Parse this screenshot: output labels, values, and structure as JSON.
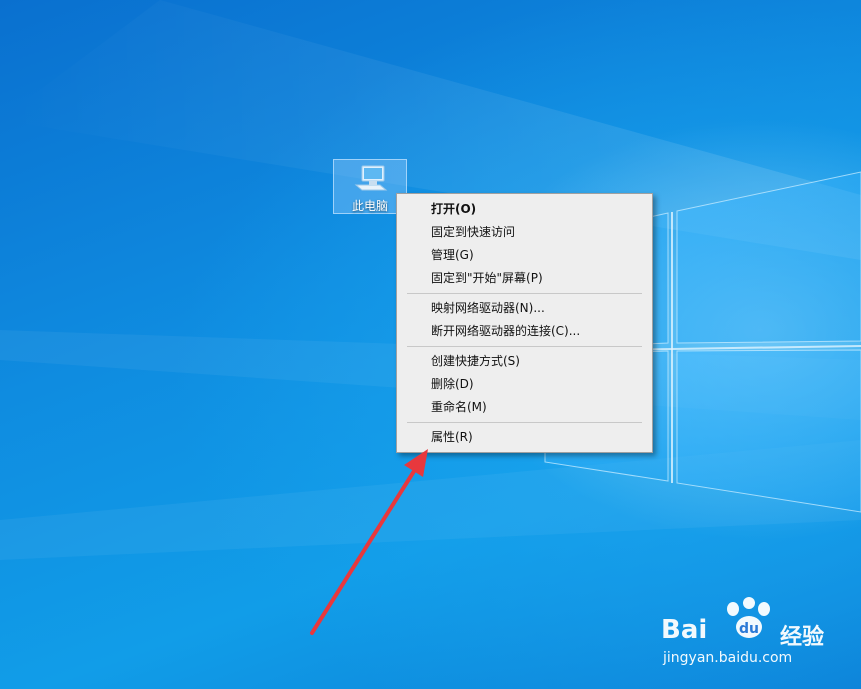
{
  "desktop": {
    "icon": {
      "label": "此电脑",
      "icon": "computer-icon"
    }
  },
  "context_menu": {
    "groups": [
      [
        {
          "label": "打开(O)",
          "bold": true
        },
        {
          "label": "固定到快速访问"
        },
        {
          "label": "管理(G)"
        },
        {
          "label": "固定到\"开始\"屏幕(P)"
        }
      ],
      [
        {
          "label": "映射网络驱动器(N)..."
        },
        {
          "label": "断开网络驱动器的连接(C)..."
        }
      ],
      [
        {
          "label": "创建快捷方式(S)"
        },
        {
          "label": "删除(D)"
        },
        {
          "label": "重命名(M)"
        }
      ],
      [
        {
          "label": "属性(R)"
        }
      ]
    ]
  },
  "annotation": {
    "arrow_color": "#e8383d",
    "icon": "red-arrow"
  },
  "watermark": {
    "brand": "Bai",
    "brand_du": "du",
    "product": "经验",
    "url": "jingyan.baidu.com"
  },
  "colors": {
    "wallpaper": "#0f8ce0",
    "menu_background": "#eeeeee",
    "arrow": "#e8383d"
  }
}
